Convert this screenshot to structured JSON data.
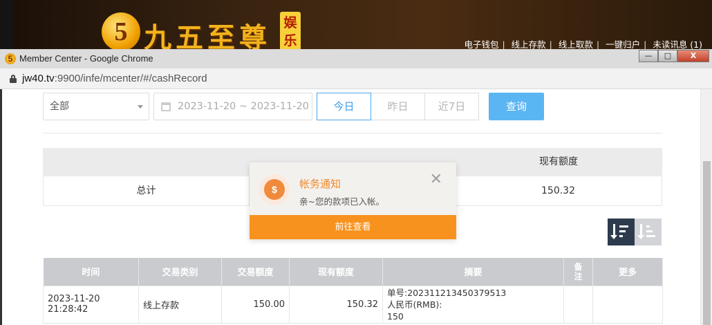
{
  "site": {
    "logo_mark": "5",
    "logo_text": "九五至尊",
    "logo_badge": "娱乐",
    "nav": [
      "电子钱包",
      "线上存款",
      "线上取款",
      "一键归户",
      "未读讯息 (1)"
    ]
  },
  "window": {
    "title": "Member Center - Google Chrome",
    "url_host": "jw40.tv",
    "url_rest": ":9900/infe/mcenter/#/cashRecord",
    "btn_min": "—",
    "btn_max": "□",
    "btn_close": "X"
  },
  "filters": {
    "type_value": "全部",
    "date_range": "2023-11-20 ~ 2023-11-20",
    "tabs": [
      "今日",
      "昨日",
      "近7日"
    ],
    "active_tab": "今日",
    "query_label": "查询"
  },
  "summary": {
    "header_balance": "现有额度",
    "total_label": "总计",
    "total_balance": "150.32"
  },
  "records": {
    "columns": [
      "时间",
      "交易类别",
      "交易额度",
      "现有额度",
      "摘要",
      "备注",
      "更多"
    ],
    "rows": [
      {
        "time": "2023-11-20 21:28:42",
        "category": "线上存款",
        "amount": "150.00",
        "balance": "150.32",
        "memo_line1": "单号:202311213450379513",
        "memo_line2": "人民币(RMB):",
        "memo_line3": "150",
        "remark": "",
        "more": ""
      }
    ]
  },
  "notification": {
    "icon": "dollar-coin-icon",
    "icon_glyph": "$",
    "title": "帐务通知",
    "message": "亲~您的款项已入帐。",
    "close_glyph": "✕",
    "action_label": "前往查看"
  },
  "colors": {
    "accent_blue": "#4aa6ee",
    "query_button": "#5bb5f3",
    "notify_orange": "#f8921e",
    "sort_active": "#2e3b4e"
  }
}
